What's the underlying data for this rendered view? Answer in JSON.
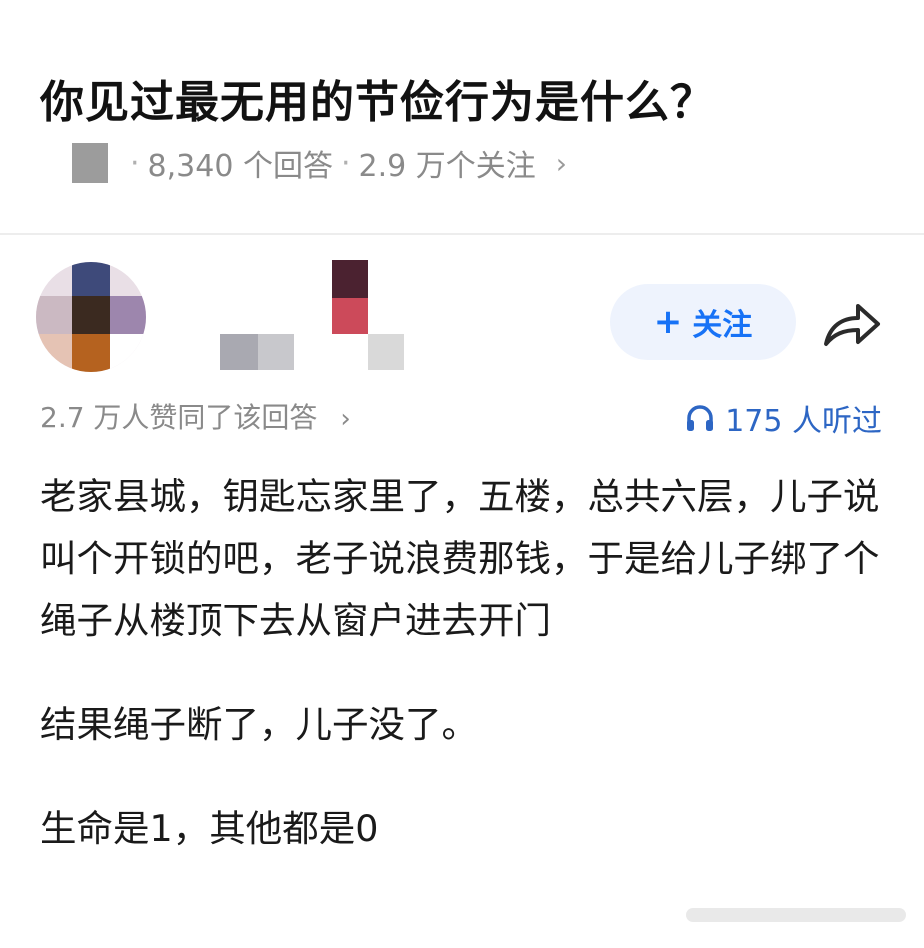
{
  "question": {
    "title": "你见过最无用的节俭行为是什么？",
    "answers_count": "8,340 个回答",
    "separator": "·",
    "followers_count": "2.9 万个关注",
    "chevron": "›"
  },
  "author": {
    "follow_button": "关注",
    "follow_plus": "+"
  },
  "stats": {
    "upvotes": "2.7 万人赞同了该回答",
    "upvote_chevron": "›",
    "listens": "175 人听过"
  },
  "answer": {
    "paragraph_1": "老家县城，钥匙忘家里了，五楼，总共六层，儿子说叫个开锁的吧，老子说浪费那钱，于是给儿子绑了个绳子从楼顶下去从窗户进去开门",
    "paragraph_2": "结果绳子断了，儿子没了。",
    "paragraph_3": "生命是1，其他都是0"
  },
  "colors": {
    "accent": "#1772f6",
    "listen": "#2d66c4",
    "muted": "#8a8a8a",
    "follow_bg": "#eef3fd"
  },
  "icons": {
    "share": "share-arrow-icon",
    "headphones": "headphones-icon"
  }
}
